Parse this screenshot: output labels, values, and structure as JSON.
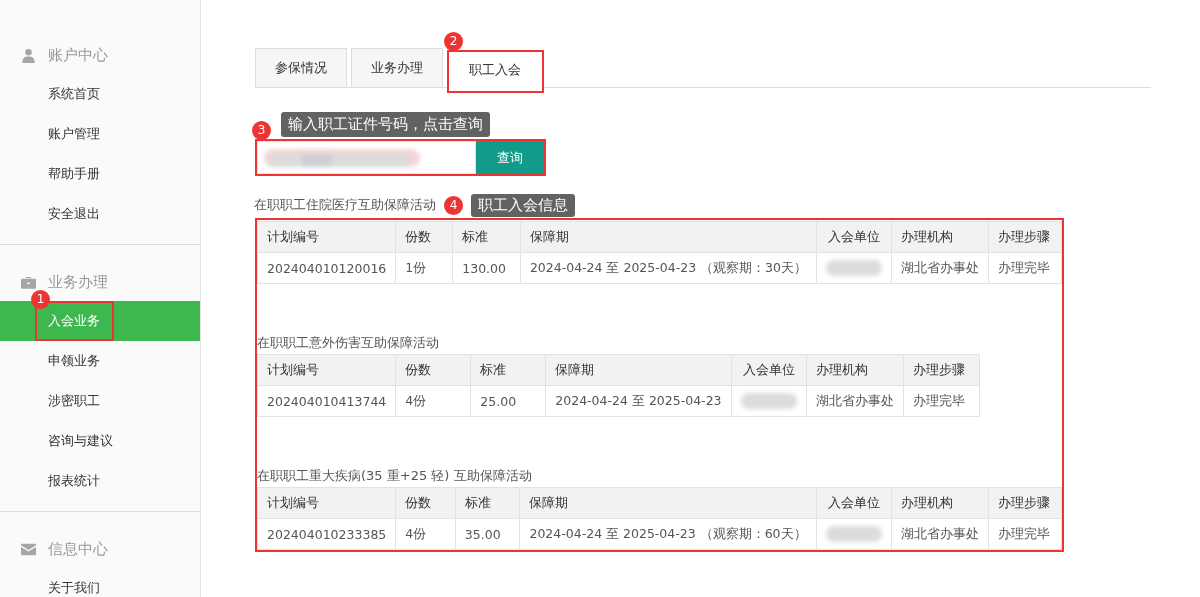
{
  "sidebar": {
    "groups": [
      {
        "title": "账户中心",
        "items": [
          {
            "label": "系统首页",
            "selected": false
          },
          {
            "label": "账户管理",
            "selected": false
          },
          {
            "label": "帮助手册",
            "selected": false
          },
          {
            "label": "安全退出",
            "selected": false
          }
        ]
      },
      {
        "title": "业务办理",
        "items": [
          {
            "label": "入会业务",
            "selected": true,
            "annotation": "1"
          },
          {
            "label": "申领业务",
            "selected": false
          },
          {
            "label": "涉密职工",
            "selected": false
          },
          {
            "label": "咨询与建议",
            "selected": false
          },
          {
            "label": "报表统计",
            "selected": false
          }
        ]
      },
      {
        "title": "信息中心",
        "items": [
          {
            "label": "关于我们",
            "selected": false
          }
        ]
      }
    ]
  },
  "tabs": [
    {
      "label": "参保情况",
      "selected": false
    },
    {
      "label": "业务办理",
      "selected": false
    },
    {
      "label": "职工入会",
      "selected": true,
      "annotation": "2"
    }
  ],
  "search": {
    "annotation": "3",
    "tooltip": "输入职工证件号码，点击查询",
    "value_redacted": true,
    "button": "查询"
  },
  "results": {
    "annotation": "4",
    "tooltip": "职工入会信息",
    "sections": [
      {
        "title": "在职职工住院医疗互助保障活动",
        "kind": "wide",
        "columns": [
          "计划编号",
          "份数",
          "标准",
          "保障期",
          "入会单位",
          "办理机构",
          "办理步骤"
        ],
        "rows": [
          {
            "cells": [
              "202404010120016",
              "1份",
              "130.00",
              "2024-04-24 至 2025-04-23 （观察期：30天）",
              null,
              "湖北省办事处",
              "办理完毕"
            ]
          }
        ]
      },
      {
        "title": "在职职工意外伤害互助保障活动",
        "kind": "compact",
        "columns": [
          "计划编号",
          "份数",
          "标准",
          "保障期",
          "入会单位",
          "办理机构",
          "办理步骤"
        ],
        "rows": [
          {
            "cells": [
              "202404010413744",
              "4份",
              "25.00",
              "2024-04-24 至 2025-04-23",
              null,
              "湖北省办事处",
              "办理完毕"
            ]
          }
        ]
      },
      {
        "title": "在职职工重大疾病(35 重+25 轻) 互助保障活动",
        "kind": "wide",
        "columns": [
          "计划编号",
          "份数",
          "标准",
          "保障期",
          "入会单位",
          "办理机构",
          "办理步骤"
        ],
        "rows": [
          {
            "cells": [
              "202404010233385",
              "4份",
              "35.00",
              "2024-04-24 至 2025-04-23 （观察期：60天）",
              null,
              "湖北省办事处",
              "办理完毕"
            ]
          }
        ]
      }
    ]
  }
}
